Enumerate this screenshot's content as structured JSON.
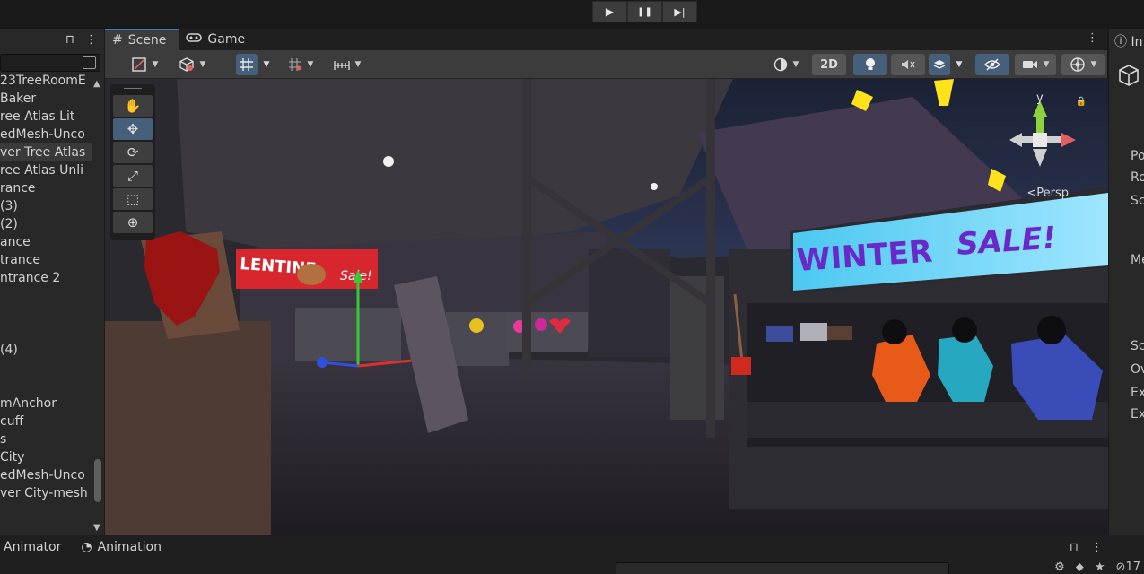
{
  "playbar": {
    "play": "▶",
    "pause": "❚❚",
    "step": "▶|"
  },
  "hierarchy": {
    "items": [
      "23TreeRoomE",
      " Baker",
      "ree Atlas Lit",
      "edMesh-Unco",
      "ver Tree Atlas",
      "ree Atlas Unli",
      "rance",
      "(3)",
      "(2)",
      "ance",
      "trance",
      "ntrance 2",
      "",
      "",
      "",
      "(4)",
      "",
      "",
      "mAnchor",
      "cuff",
      "s",
      "City",
      "edMesh-Unco",
      "ver City-mesh"
    ],
    "selected_index": 4
  },
  "scene": {
    "tabs": [
      {
        "label": "Scene",
        "icon": "grid-icon"
      },
      {
        "label": "Game",
        "icon": "gamepad-icon"
      }
    ],
    "toolbar": {
      "mode_2d": "2D"
    },
    "persp_label": "<Persp",
    "gizmo_axis_label": "y"
  },
  "inspector": {
    "tab_label": "In",
    "rows": [
      "Po",
      "Ro",
      "Sc",
      "Me",
      "Sc",
      "Ov",
      "Ex",
      "Ex"
    ]
  },
  "bottom": {
    "tabs": [
      {
        "label": "Animator",
        "icon": "animator-icon"
      },
      {
        "label": "Animation",
        "icon": "animation-clock-icon"
      }
    ],
    "hidden_count": "17"
  },
  "colors": {
    "accent": "#3a79bb",
    "panel": "#282828",
    "toolbar": "#3c3c3c",
    "active_button": "#46607c"
  }
}
